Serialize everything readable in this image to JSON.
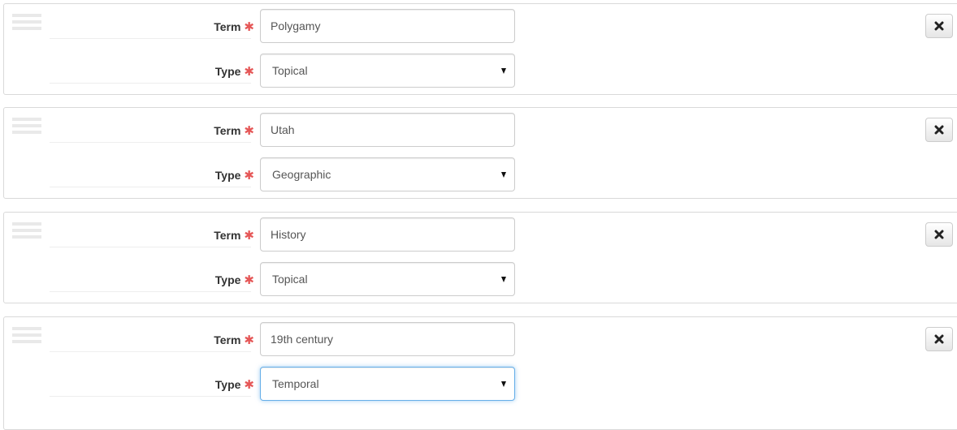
{
  "term_label": "Term",
  "type_label": "Type",
  "required_marker": "✱",
  "subjects": [
    {
      "term": "Polygamy",
      "type": "Topical"
    },
    {
      "term": "Utah",
      "type": "Geographic"
    },
    {
      "term": "History",
      "type": "Topical"
    },
    {
      "term": "19th century",
      "type": "Temporal"
    }
  ],
  "colors": {
    "required": "#e55757",
    "focus_border": "#66afe9",
    "panel_border": "#d9d9d9"
  }
}
